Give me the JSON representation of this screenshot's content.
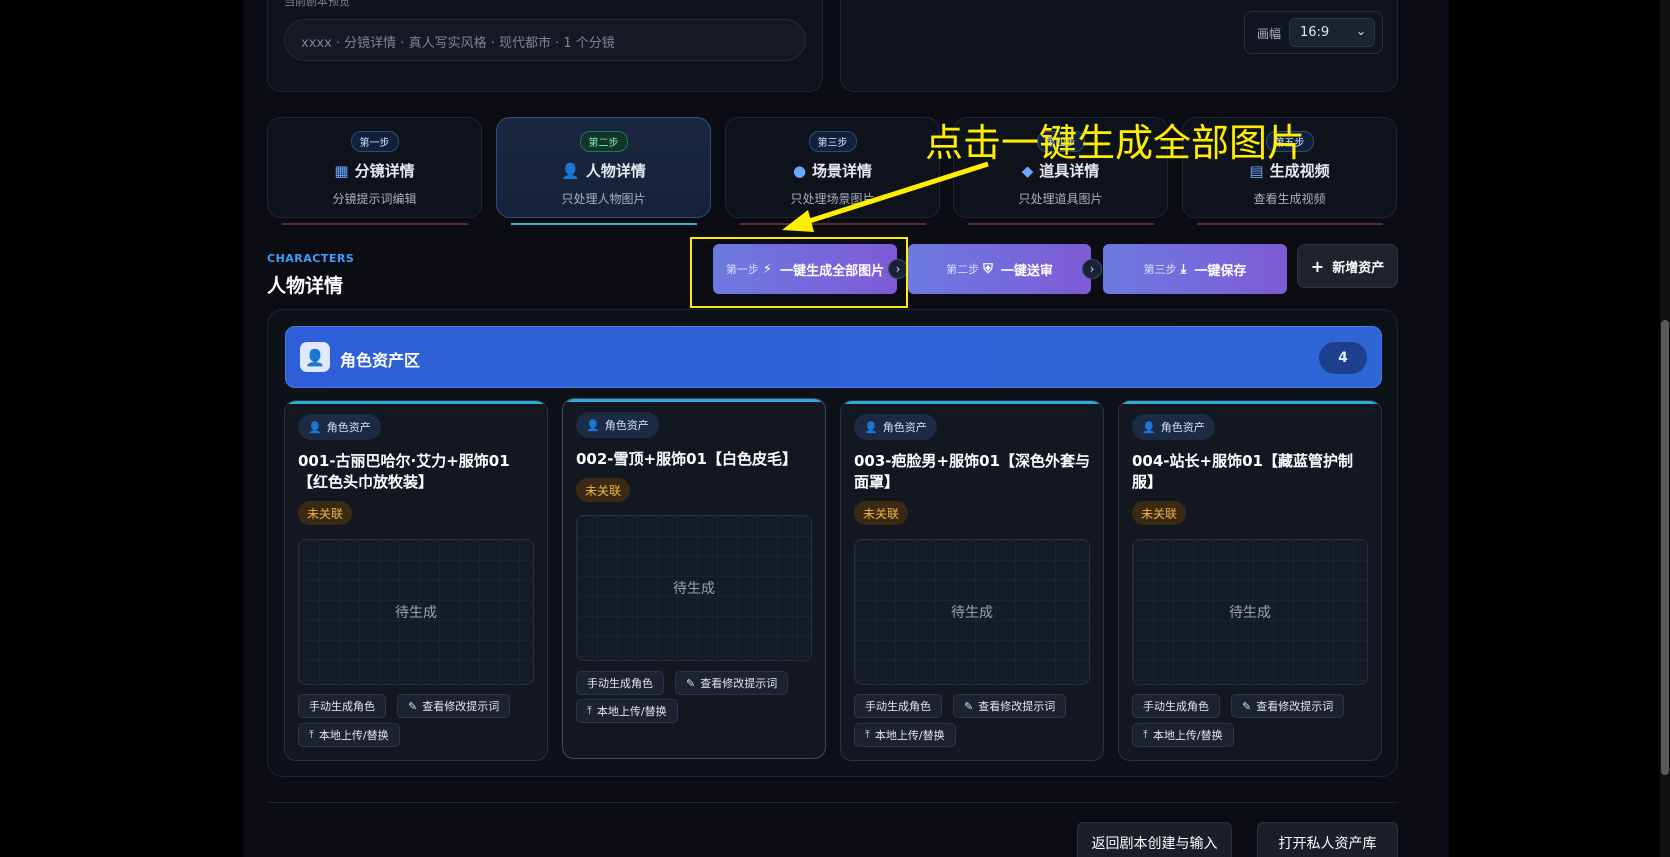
{
  "script_panel": {
    "cut_label": "当前剧本预览",
    "summary": "xxxx · 分镜详情 · 真人写实风格 · 现代都市 · 1 个分镜"
  },
  "ratio": {
    "label": "画幅",
    "value": "16:9"
  },
  "steps": [
    {
      "badge": "第一步",
      "title": "分镜详情",
      "sub": "分镜提示词编辑",
      "icon": "grid-icon"
    },
    {
      "badge": "第二步",
      "title": "人物详情",
      "sub": "只处理人物图片",
      "icon": "user-icon"
    },
    {
      "badge": "第三步",
      "title": "场景详情",
      "sub": "只处理场景图片",
      "icon": "location-pin-icon"
    },
    {
      "badge": "第四步",
      "title": "道具详情",
      "sub": "只处理道具图片",
      "icon": "cube-icon"
    },
    {
      "badge": "第五步",
      "title": "生成视频",
      "sub": "查看生成视频",
      "icon": "film-icon"
    }
  ],
  "section": {
    "tag": "CHARACTERS",
    "title": "人物详情"
  },
  "actions": [
    {
      "step": "第一步",
      "label": "一键生成全部图片",
      "icon": "bolt-icon"
    },
    {
      "step": "第二步",
      "label": "一键送审",
      "icon": "shield-icon"
    },
    {
      "step": "第三步",
      "label": "一键保存",
      "icon": "download-icon"
    }
  ],
  "add_asset": "新增资产",
  "asset_area": {
    "title": "角色资产区",
    "count": "4"
  },
  "cards": [
    {
      "tag": "角色资产",
      "name": "001-古丽巴哈尔·艾力+服饰01【红色头巾放牧装】",
      "state": "未关联",
      "preview": "待生成",
      "btn_manual": "手动生成角色",
      "btn_edit": "查看修改提示词",
      "btn_upload": "本地上传/替换"
    },
    {
      "tag": "角色资产",
      "name": "002-雪顶+服饰01【白色皮毛】",
      "state": "未关联",
      "preview": "待生成",
      "btn_manual": "手动生成角色",
      "btn_edit": "查看修改提示词",
      "btn_upload": "本地上传/替换"
    },
    {
      "tag": "角色资产",
      "name": "003-疤脸男+服饰01【深色外套与面罩】",
      "state": "未关联",
      "preview": "待生成",
      "btn_manual": "手动生成角色",
      "btn_edit": "查看修改提示词",
      "btn_upload": "本地上传/替换"
    },
    {
      "tag": "角色资产",
      "name": "004-站长+服饰01【藏蓝管护制服】",
      "state": "未关联",
      "preview": "待生成",
      "btn_manual": "手动生成角色",
      "btn_edit": "查看修改提示词",
      "btn_upload": "本地上传/替换"
    }
  ],
  "bottom": {
    "back": "返回剧本创建与输入",
    "open_lib": "打开私人资产库"
  },
  "annotation": {
    "text": "点击一键生成全部图片"
  },
  "colors": {
    "accent": "#3aa0ff",
    "annotation": "#ffee00",
    "pending": "#f2b541"
  }
}
